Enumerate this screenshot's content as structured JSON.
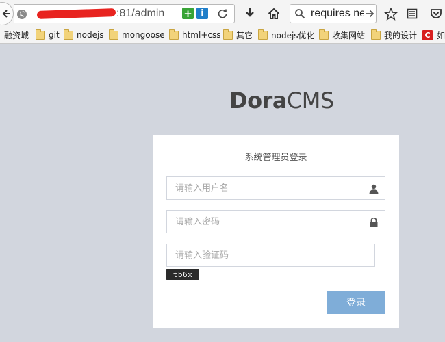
{
  "browser": {
    "url_visible": ":81/admin",
    "search_query": "requires ne"
  },
  "bookmarks": [
    {
      "label": "融资城",
      "icon": "none"
    },
    {
      "label": "git",
      "icon": "folder-icon"
    },
    {
      "label": "nodejs",
      "icon": "folder-icon"
    },
    {
      "label": "mongoose",
      "icon": "folder-icon"
    },
    {
      "label": "html+css",
      "icon": "folder-icon"
    },
    {
      "label": "其它",
      "icon": "folder-icon"
    },
    {
      "label": "nodejs优化",
      "icon": "folder-icon"
    },
    {
      "label": "收集网站",
      "icon": "folder-icon"
    },
    {
      "label": "我的设计",
      "icon": "folder-icon"
    },
    {
      "label": "如",
      "icon": "c-logo-icon",
      "icon_letter": "C"
    }
  ],
  "brand": {
    "bold": "Dora",
    "light": "CMS"
  },
  "login": {
    "title": "系统管理员登录",
    "username_placeholder": "请输入用户名",
    "password_placeholder": "请输入密码",
    "captcha_placeholder": "请输入验证码",
    "captcha_text": "tb6x",
    "submit_label": "登录"
  },
  "colors": {
    "page_background": "#d2d6de",
    "login_button": "#7fadd8",
    "redaction": "#e8231f"
  }
}
